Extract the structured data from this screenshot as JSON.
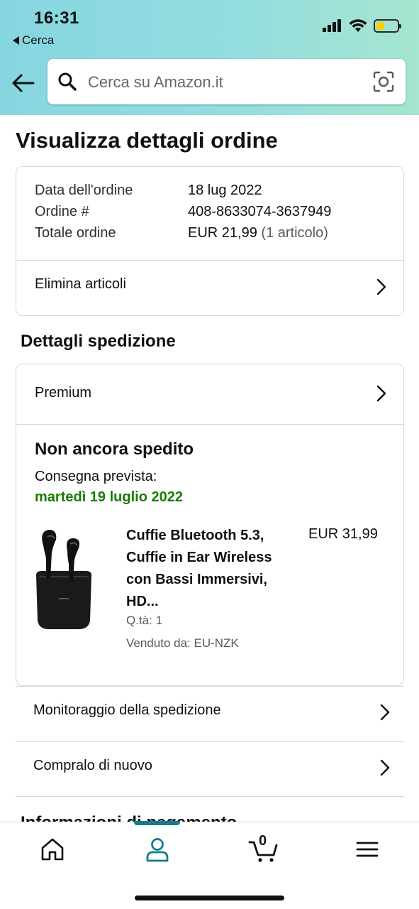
{
  "status_bar": {
    "time": "16:31",
    "back_app": "Cerca"
  },
  "search": {
    "placeholder": "Cerca su Amazon.it"
  },
  "page": {
    "title": "Visualizza dettagli ordine"
  },
  "order_summary": {
    "rows": [
      {
        "label": "Data dell'ordine",
        "value": "18 lug 2022"
      },
      {
        "label": "Ordine #",
        "value": "408-8633074-3637949"
      },
      {
        "label": "Totale ordine",
        "value": "EUR 21,99",
        "extra": "(1 articolo)"
      }
    ],
    "action": "Elimina articoli"
  },
  "shipment": {
    "section_title": "Dettagli spedizione",
    "shipping_speed": "Premium",
    "status": "Non ancora spedito",
    "delivery_label": "Consegna prevista:",
    "delivery_date": "martedì 19 luglio 2022",
    "product": {
      "title": "Cuffie Bluetooth 5.3, Cuffie in Ear Wireless con Bassi Immersivi, HD...",
      "price": "EUR 31,99",
      "quantity": "Q.tà: 1",
      "seller": "Venduto da: EU-NZK"
    }
  },
  "actions": [
    {
      "label": "Monitoraggio della spedizione"
    },
    {
      "label": "Compralo di nuovo"
    }
  ],
  "next_section_partial": "Informazioni di pagamento",
  "tab_bar": {
    "cart_count": "0",
    "active_tab": "account"
  },
  "colors": {
    "delivery_green": "#167e00",
    "tab_accent": "#167c8c",
    "header_start": "#86d6e0",
    "header_end": "#a6e5d0"
  }
}
